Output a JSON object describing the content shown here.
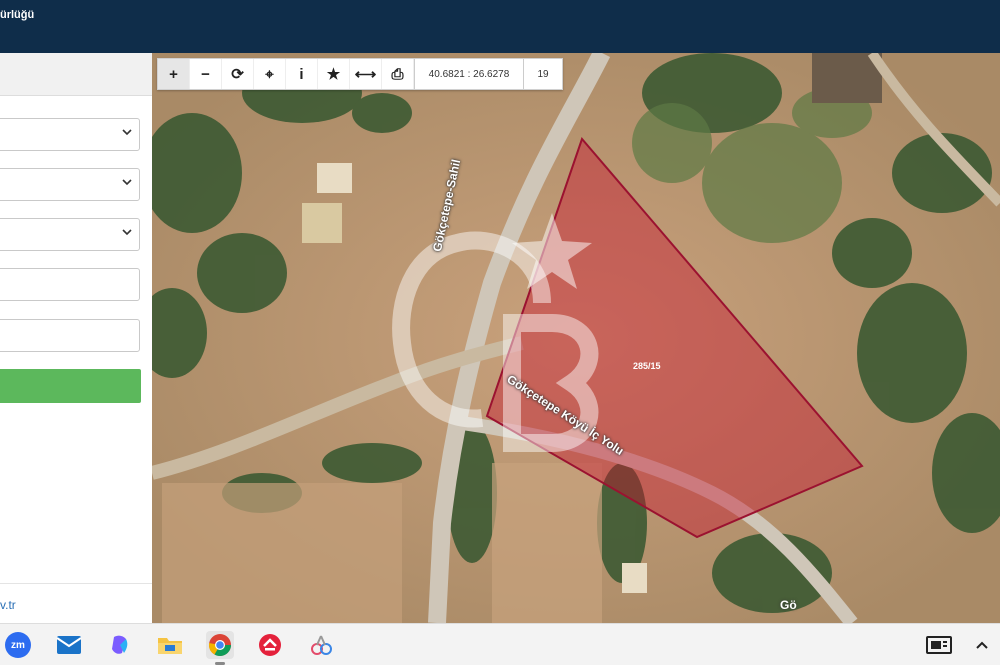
{
  "header": {
    "title": "ürlüğü"
  },
  "sidebar": {
    "footer_link": "v.tr"
  },
  "map": {
    "toolbar": {
      "zoom_in": "+",
      "zoom_out": "−",
      "refresh": "⟳",
      "locate": "⌖",
      "info": "i",
      "favorite": "★",
      "measure": "⟷",
      "print": "⎙",
      "coordinates": "40.6821 : 26.6278",
      "zoom_level": "19"
    },
    "parcel_label": "285/15",
    "road_label_1": "Gökçetepe-Sahil",
    "road_label_2": "Gökçetepe Köyü İç Yolu",
    "road_label_3": "Gö",
    "parcel_color": "#c8102e"
  },
  "taskbar": {
    "apps": [
      "zoom-icon",
      "mail-icon",
      "copilot-icon",
      "file-explorer-icon",
      "chrome-icon",
      "app-red-icon",
      "paint-icon"
    ],
    "tray": [
      "display-icon",
      "chevron-up-icon"
    ]
  }
}
